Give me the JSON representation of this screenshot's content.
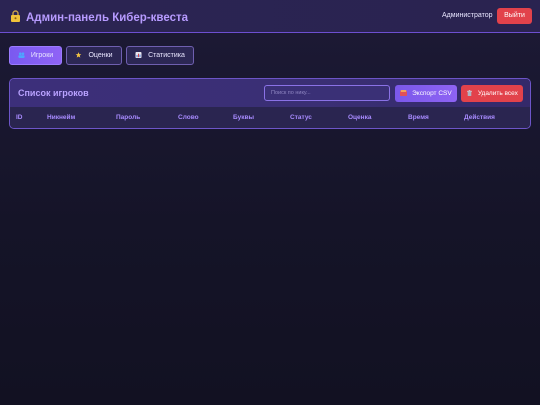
{
  "header": {
    "title": "Админ-панель Кибер-квеста",
    "title_icon": "lock-icon",
    "user": "Администратор",
    "logout_label": "Выйти"
  },
  "tabs": [
    {
      "label": "Игроки",
      "icon": "users-icon",
      "active": true
    },
    {
      "label": "Оценки",
      "icon": "star-icon",
      "active": false
    },
    {
      "label": "Статистика",
      "icon": "chart-icon",
      "active": false
    }
  ],
  "players_panel": {
    "title": "Список игроков",
    "search_placeholder": "Поиск по нику...",
    "export_label": "Экспорт CSV",
    "delete_all_label": "Удалить всех",
    "columns": [
      "ID",
      "Никнейм",
      "Пароль",
      "Слово",
      "Буквы",
      "Статус",
      "Оценка",
      "Время",
      "Действия"
    ],
    "rows": []
  },
  "colors": {
    "accent": "#8b62f4",
    "danger": "#e2424b",
    "background": "#16152b",
    "heading": "#b79bff"
  }
}
